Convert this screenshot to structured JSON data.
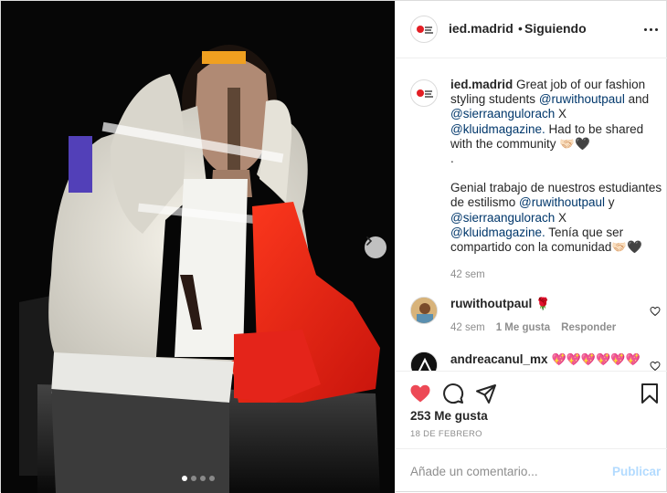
{
  "colors": {
    "like_red": "#ed4956",
    "link": "#00376b",
    "publish_disabled": "#b3dbff",
    "muted": "#8e8e8e"
  },
  "media": {
    "alt": "Fashion photo",
    "next_icon": "chevron-right-icon",
    "slides_total": 4,
    "active_slide": 1
  },
  "header": {
    "username": "ied.madrid",
    "separator": "•",
    "follow_status": "Siguiendo",
    "more_icon": "more-horizontal-icon"
  },
  "caption": {
    "username": "ied.madrid",
    "line1_text": " Great job of our fashion styling students ",
    "mention1": "@ruwithoutpaul",
    "line1_and": " and ",
    "mention2": "@sierraangulorach",
    "x_sep": " X ",
    "mention3": "@kluidmagazine.",
    "line1_end": " Had to be shared with the community",
    "emoji1": "🤝🏻🖤",
    "dot": ".",
    "es_text": "Genial trabajo de nuestros estudiantes de estilismo ",
    "es_mention1": "@ruwithoutpaul",
    "es_y": " y ",
    "es_mention2": "@sierraangulorach",
    "es_x": " X ",
    "es_mention3": "@kluidmagazine.",
    "es_end": " Tenía que ser compartido con la comunidad",
    "emoji2": "🤝🏻🖤",
    "time": "42 sem"
  },
  "comments": [
    {
      "username": "ruwithoutpaul",
      "text": "🌹",
      "time": "42 sem",
      "likes": "1 Me gusta",
      "reply": "Responder"
    },
    {
      "username": "andreacanul_mx",
      "text": "💖💖💖💖💖💖"
    }
  ],
  "actions": {
    "like_icon": "heart-filled-icon",
    "comment_icon": "comment-icon",
    "share_icon": "send-icon",
    "save_icon": "bookmark-icon"
  },
  "likes_count": "253 Me gusta",
  "date": "18 DE FEBRERO",
  "add_comment": {
    "placeholder": "Añade un comentario...",
    "publish_label": "Publicar"
  }
}
